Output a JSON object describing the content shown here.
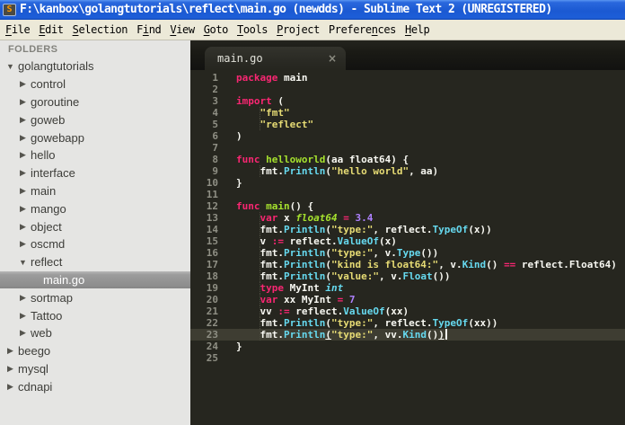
{
  "titlebar": {
    "icon": "S",
    "title": "F:\\kanbox\\golangtutorials\\reflect\\main.go (newdds) - Sublime Text 2 (UNREGISTERED)"
  },
  "menu": {
    "items": [
      {
        "label": "File",
        "u": 0
      },
      {
        "label": "Edit",
        "u": 0
      },
      {
        "label": "Selection",
        "u": 0
      },
      {
        "label": "Find",
        "u": 1
      },
      {
        "label": "View",
        "u": 0
      },
      {
        "label": "Goto",
        "u": 0
      },
      {
        "label": "Tools",
        "u": 0
      },
      {
        "label": "Project",
        "u": 0
      },
      {
        "label": "Preferences",
        "u": 7
      },
      {
        "label": "Help",
        "u": 0
      }
    ]
  },
  "sidebar": {
    "header": "FOLDERS",
    "items": [
      {
        "label": "golangtutorials",
        "level": 0,
        "type": "dir",
        "expanded": true
      },
      {
        "label": "control",
        "level": 1,
        "type": "dir",
        "expanded": false
      },
      {
        "label": "goroutine",
        "level": 1,
        "type": "dir",
        "expanded": false
      },
      {
        "label": "goweb",
        "level": 1,
        "type": "dir",
        "expanded": false
      },
      {
        "label": "gowebapp",
        "level": 1,
        "type": "dir",
        "expanded": false
      },
      {
        "label": "hello",
        "level": 1,
        "type": "dir",
        "expanded": false
      },
      {
        "label": "interface",
        "level": 1,
        "type": "dir",
        "expanded": false
      },
      {
        "label": "main",
        "level": 1,
        "type": "dir",
        "expanded": false
      },
      {
        "label": "mango",
        "level": 1,
        "type": "dir",
        "expanded": false
      },
      {
        "label": "object",
        "level": 1,
        "type": "dir",
        "expanded": false
      },
      {
        "label": "oscmd",
        "level": 1,
        "type": "dir",
        "expanded": false
      },
      {
        "label": "reflect",
        "level": 1,
        "type": "dir",
        "expanded": true
      },
      {
        "label": "main.go",
        "level": 2,
        "type": "file",
        "selected": true
      },
      {
        "label": "sortmap",
        "level": 1,
        "type": "dir",
        "expanded": false
      },
      {
        "label": "Tattoo",
        "level": 1,
        "type": "dir",
        "expanded": false
      },
      {
        "label": "web",
        "level": 1,
        "type": "dir",
        "expanded": false
      },
      {
        "label": "beego",
        "level": 0,
        "type": "dir",
        "expanded": false
      },
      {
        "label": "mysql",
        "level": 0,
        "type": "dir",
        "expanded": false
      },
      {
        "label": "cdnapi",
        "level": 0,
        "type": "dir",
        "expanded": false
      }
    ]
  },
  "editor": {
    "tab": {
      "label": "main.go",
      "close": "×"
    },
    "lines": [
      {
        "n": 1,
        "t": [
          [
            "kw",
            "package"
          ],
          [
            "pl",
            " main"
          ]
        ]
      },
      {
        "n": 2,
        "t": []
      },
      {
        "n": 3,
        "t": [
          [
            "kw",
            "import"
          ],
          [
            "pl",
            " ("
          ]
        ]
      },
      {
        "n": 4,
        "guide": true,
        "t": [
          [
            "pl",
            "    "
          ],
          [
            "str",
            "\"fmt\""
          ]
        ]
      },
      {
        "n": 5,
        "guide": true,
        "t": [
          [
            "pl",
            "    "
          ],
          [
            "str",
            "\"reflect\""
          ]
        ]
      },
      {
        "n": 6,
        "t": [
          [
            "pl",
            ")"
          ]
        ]
      },
      {
        "n": 7,
        "t": []
      },
      {
        "n": 8,
        "t": [
          [
            "kw",
            "func"
          ],
          [
            "pl",
            " "
          ],
          [
            "fn",
            "helloworld"
          ],
          [
            "pl",
            "(aa float64) {"
          ]
        ]
      },
      {
        "n": 9,
        "guide": true,
        "t": [
          [
            "pl",
            "    fmt."
          ],
          [
            "call",
            "Println"
          ],
          [
            "pl",
            "("
          ],
          [
            "str",
            "\"hello world\""
          ],
          [
            "pl",
            ", aa)"
          ]
        ]
      },
      {
        "n": 10,
        "t": [
          [
            "pl",
            "}"
          ]
        ]
      },
      {
        "n": 11,
        "t": []
      },
      {
        "n": 12,
        "t": [
          [
            "kw",
            "func"
          ],
          [
            "pl",
            " "
          ],
          [
            "fn",
            "main"
          ],
          [
            "pl",
            "() {"
          ]
        ]
      },
      {
        "n": 13,
        "guide": true,
        "t": [
          [
            "pl",
            "    "
          ],
          [
            "kw",
            "var"
          ],
          [
            "pl",
            " x "
          ],
          [
            "tyg",
            "float64"
          ],
          [
            "pl",
            " "
          ],
          [
            "kw",
            "="
          ],
          [
            "pl",
            " "
          ],
          [
            "num",
            "3.4"
          ]
        ]
      },
      {
        "n": 14,
        "guide": true,
        "t": [
          [
            "pl",
            "    fmt."
          ],
          [
            "call",
            "Println"
          ],
          [
            "pl",
            "("
          ],
          [
            "str",
            "\"type:\""
          ],
          [
            "pl",
            ", reflect."
          ],
          [
            "call",
            "TypeOf"
          ],
          [
            "pl",
            "(x))"
          ]
        ]
      },
      {
        "n": 15,
        "guide": true,
        "t": [
          [
            "pl",
            "    v "
          ],
          [
            "kw",
            ":="
          ],
          [
            "pl",
            " reflect."
          ],
          [
            "call",
            "ValueOf"
          ],
          [
            "pl",
            "(x)"
          ]
        ]
      },
      {
        "n": 16,
        "guide": true,
        "t": [
          [
            "pl",
            "    fmt."
          ],
          [
            "call",
            "Println"
          ],
          [
            "pl",
            "("
          ],
          [
            "str",
            "\"type:\""
          ],
          [
            "pl",
            ", v."
          ],
          [
            "call",
            "Type"
          ],
          [
            "pl",
            "())"
          ]
        ]
      },
      {
        "n": 17,
        "guide": true,
        "t": [
          [
            "pl",
            "    fmt."
          ],
          [
            "call",
            "Println"
          ],
          [
            "pl",
            "("
          ],
          [
            "str",
            "\"kind is float64:\""
          ],
          [
            "pl",
            ", v."
          ],
          [
            "call",
            "Kind"
          ],
          [
            "pl",
            "() "
          ],
          [
            "kw",
            "=="
          ],
          [
            "pl",
            " reflect.Float64)"
          ]
        ]
      },
      {
        "n": 18,
        "guide": true,
        "t": [
          [
            "pl",
            "    fmt."
          ],
          [
            "call",
            "Println"
          ],
          [
            "pl",
            "("
          ],
          [
            "str",
            "\"value:\""
          ],
          [
            "pl",
            ", v."
          ],
          [
            "call",
            "Float"
          ],
          [
            "pl",
            "())"
          ]
        ]
      },
      {
        "n": 19,
        "guide": true,
        "t": [
          [
            "pl",
            "    "
          ],
          [
            "kw",
            "type"
          ],
          [
            "pl",
            " MyInt "
          ],
          [
            "tyc",
            "int"
          ]
        ]
      },
      {
        "n": 20,
        "guide": true,
        "t": [
          [
            "pl",
            "    "
          ],
          [
            "kw",
            "var"
          ],
          [
            "pl",
            " xx MyInt "
          ],
          [
            "kw",
            "="
          ],
          [
            "pl",
            " "
          ],
          [
            "num",
            "7"
          ]
        ]
      },
      {
        "n": 21,
        "guide": true,
        "t": [
          [
            "pl",
            "    vv "
          ],
          [
            "kw",
            ":="
          ],
          [
            "pl",
            " reflect."
          ],
          [
            "call",
            "ValueOf"
          ],
          [
            "pl",
            "(xx)"
          ]
        ]
      },
      {
        "n": 22,
        "guide": true,
        "t": [
          [
            "pl",
            "    fmt."
          ],
          [
            "call",
            "Println"
          ],
          [
            "pl",
            "("
          ],
          [
            "str",
            "\"type:\""
          ],
          [
            "pl",
            ", reflect."
          ],
          [
            "call",
            "TypeOf"
          ],
          [
            "pl",
            "(xx))"
          ]
        ]
      },
      {
        "n": 23,
        "guide": true,
        "current": true,
        "cursor": true,
        "t": [
          [
            "pl",
            "    fmt."
          ],
          [
            "call",
            "Println"
          ],
          [
            "pl br",
            "("
          ],
          [
            "str",
            "\"type:\""
          ],
          [
            "pl",
            ", vv."
          ],
          [
            "call",
            "Kind"
          ],
          [
            "pl",
            "()"
          ],
          [
            "pl br",
            ")"
          ]
        ]
      },
      {
        "n": 24,
        "t": [
          [
            "pl",
            "}"
          ]
        ]
      },
      {
        "n": 25,
        "t": []
      }
    ]
  },
  "colors": {
    "editor_bg": "#272822",
    "foreground": "#f8f8f2",
    "keyword": "#f92672",
    "string": "#e6db74",
    "function_name": "#a6e22e",
    "function_call": "#66d9ef",
    "number": "#ae81ff",
    "line_number": "#8f8f84",
    "current_line": "#3e3d32",
    "titlebar_blue": "#1b59d2",
    "menubar_bg": "#ece9d8",
    "sidebar_bg": "#e5e5e3"
  }
}
